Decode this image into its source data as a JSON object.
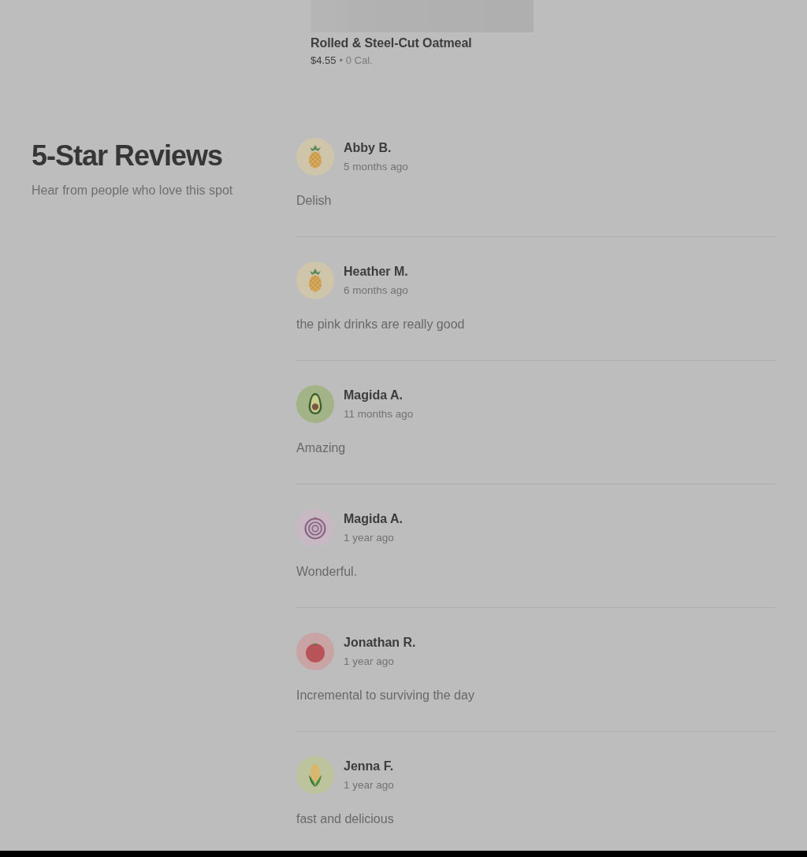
{
  "product_card": {
    "title": "Rolled & Steel-Cut Oatmeal",
    "price": "$4.55",
    "calories": "• 0 Cal."
  },
  "reviews_section": {
    "title": "5-Star Reviews",
    "subtitle": "Hear from people who love this spot"
  },
  "reviews": [
    {
      "kind": "pineapple",
      "name": "Abby B.",
      "time": "5 months ago",
      "comment": "Delish"
    },
    {
      "kind": "pineapple",
      "name": "Heather M.",
      "time": "6 months ago",
      "comment": "the pink drinks are really good"
    },
    {
      "kind": "avocado",
      "name": "Magida A.",
      "time": "11 months ago",
      "comment": "Amazing"
    },
    {
      "kind": "onion",
      "name": "Magida A.",
      "time": "1 year ago",
      "comment": "Wonderful."
    },
    {
      "kind": "tomato",
      "name": "Jonathan R.",
      "time": "1 year ago",
      "comment": "Incremental to surviving the day"
    },
    {
      "kind": "corn",
      "name": "Jenna F.",
      "time": "1 year ago",
      "comment": "fast and delicious"
    }
  ]
}
